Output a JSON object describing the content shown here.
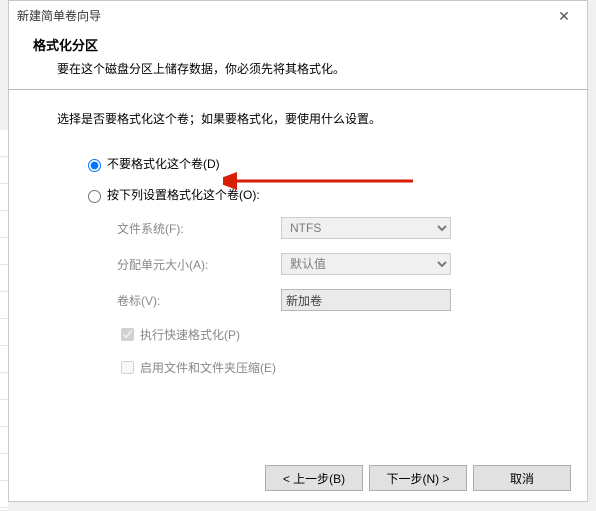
{
  "titlebar": {
    "title": "新建简单卷向导",
    "close_icon": "✕"
  },
  "header": {
    "title": "格式化分区",
    "desc": "要在这个磁盘分区上储存数据，你必须先将其格式化。"
  },
  "prompt": "选择是否要格式化这个卷；如果要格式化，要使用什么设置。",
  "radios": {
    "no_format": "不要格式化这个卷(D)",
    "do_format": "按下列设置格式化这个卷(O):"
  },
  "form": {
    "fs_label": "文件系统(F):",
    "fs_value": "NTFS",
    "alloc_label": "分配单元大小(A):",
    "alloc_value": "默认值",
    "vol_label": "卷标(V):",
    "vol_value": "新加卷",
    "quick_label": "执行快速格式化(P)",
    "compress_label": "启用文件和文件夹压缩(E)"
  },
  "footer": {
    "back": "< 上一步(B)",
    "next": "下一步(N) >",
    "cancel": "取消"
  }
}
